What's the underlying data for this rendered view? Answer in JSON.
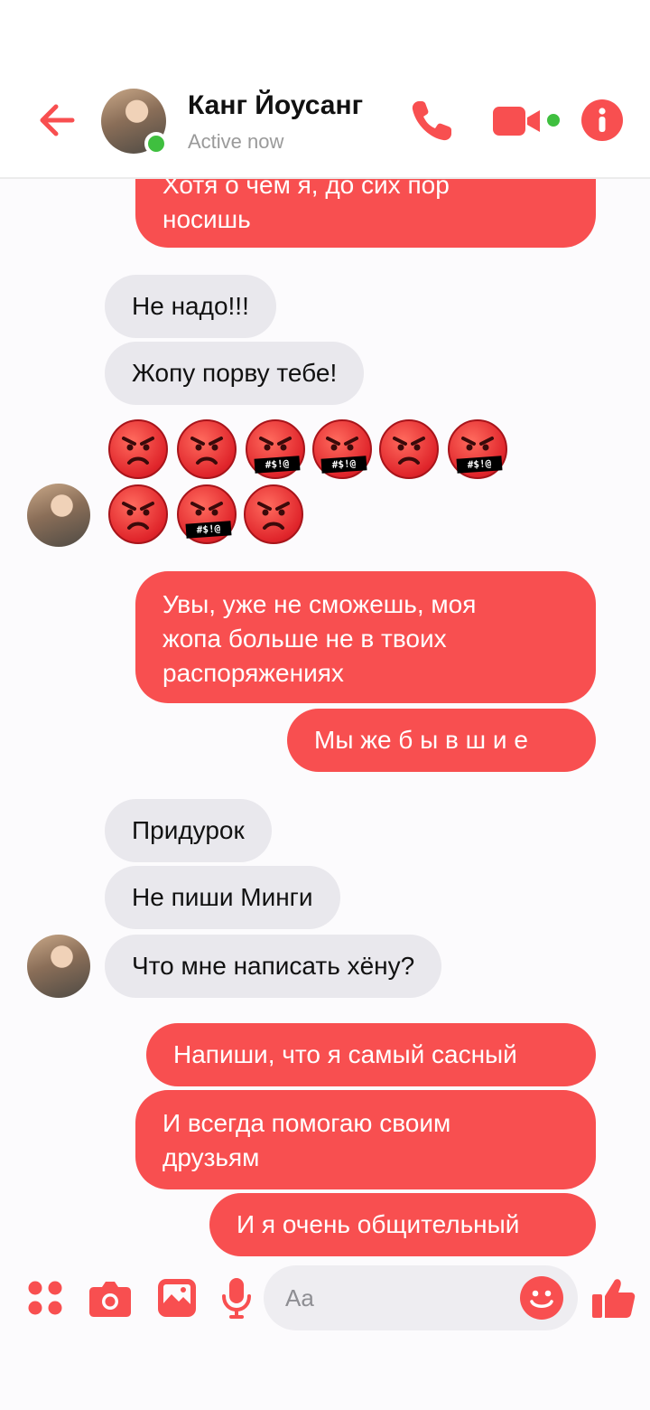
{
  "header": {
    "contact_name": "Канг Йоусанг",
    "status": "Active now"
  },
  "messages": [
    {
      "side": "out",
      "text": "Хотя о чем я, до сих пор\nносишь",
      "partially_hidden": true
    },
    {
      "side": "in",
      "text": "Не надо!!!"
    },
    {
      "side": "in",
      "text": "Жопу порву тебе!"
    },
    {
      "side": "in",
      "type": "emoji",
      "emojis": [
        "angry",
        "angry",
        "cursing",
        "cursing",
        "angry",
        "cursing",
        "angry",
        "cursing",
        "angry"
      ]
    },
    {
      "side": "out",
      "text": "Увы, уже не сможешь, моя\nжопа больше не в твоих\nраспоряжениях"
    },
    {
      "side": "out",
      "text": "Мы же  б ы в ш и е"
    },
    {
      "side": "in",
      "text": "Придурок"
    },
    {
      "side": "in",
      "text": "Не пиши Минги"
    },
    {
      "side": "in",
      "text": "Что мне написать хёну?"
    },
    {
      "side": "out",
      "text": "Напиши, что я самый сасный"
    },
    {
      "side": "out",
      "text": "И всегда помогаю своим\nдрузьям"
    },
    {
      "side": "out",
      "text": "И я очень общительный"
    }
  ],
  "emoji_censor_text": "#$!@",
  "composer": {
    "placeholder": "Aa",
    "tools": [
      "grid-menu-icon",
      "camera-icon",
      "gallery-icon",
      "microphone-icon"
    ]
  },
  "colors": {
    "accent": "#f84f50",
    "incoming_bubble": "#e9e8ed",
    "online": "#3fbf3f"
  }
}
